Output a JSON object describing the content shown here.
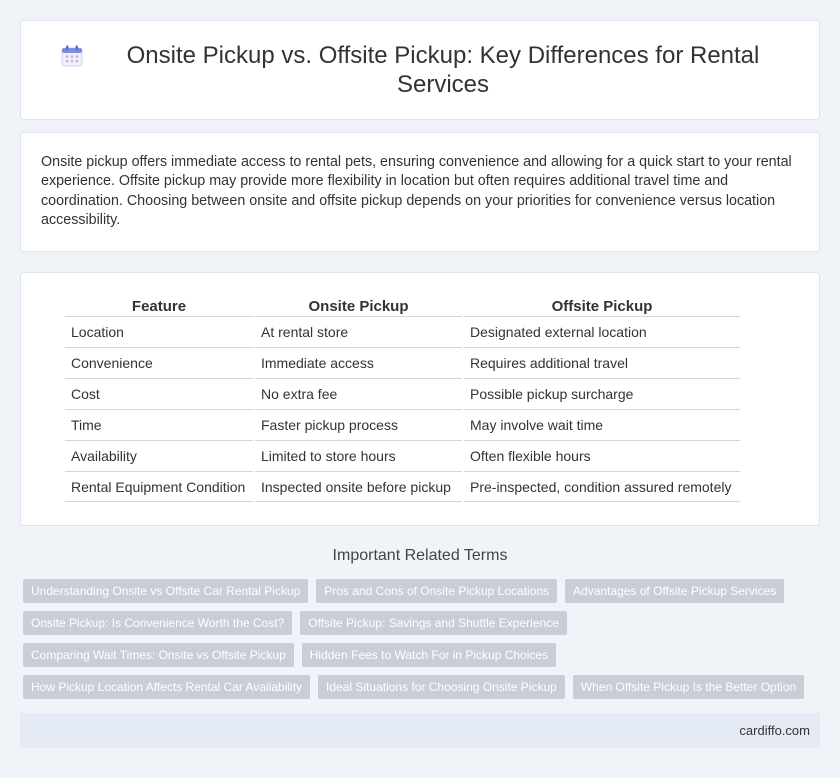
{
  "header": {
    "title": "Onsite Pickup vs. Offsite Pickup: Key Differences for Rental Services",
    "icon": "calendar-icon"
  },
  "intro": {
    "text": "Onsite pickup offers immediate access to rental pets, ensuring convenience and allowing for a quick start to your rental experience. Offsite pickup may provide more flexibility in location but often requires additional travel time and coordination. Choosing between onsite and offsite pickup depends on your priorities for convenience versus location accessibility."
  },
  "table": {
    "headers": [
      "Feature",
      "Onsite Pickup",
      "Offsite Pickup"
    ],
    "rows": [
      [
        "Location",
        "At rental store",
        "Designated external location"
      ],
      [
        "Convenience",
        "Immediate access",
        "Requires additional travel"
      ],
      [
        "Cost",
        "No extra fee",
        "Possible pickup surcharge"
      ],
      [
        "Time",
        "Faster pickup process",
        "May involve wait time"
      ],
      [
        "Availability",
        "Limited to store hours",
        "Often flexible hours"
      ],
      [
        "Rental Equipment Condition",
        "Inspected onsite before pickup",
        "Pre-inspected, condition assured remotely"
      ]
    ]
  },
  "related": {
    "title": "Important Related Terms",
    "rows": [
      [
        "Understanding Onsite vs Offsite Car Rental Pickup",
        "Pros and Cons of Onsite Pickup Locations",
        "Advantages of Offsite Pickup Services"
      ],
      [
        "Onsite Pickup: Is Convenience Worth the Cost?",
        "Offsite Pickup: Savings and Shuttle Experience"
      ],
      [
        "Comparing Wait Times: Onsite vs Offsite Pickup",
        "Hidden Fees to Watch For in Pickup Choices"
      ],
      [
        "How Pickup Location Affects Rental Car Availability",
        "Ideal Situations for Choosing Onsite Pickup",
        "When Offsite Pickup Is the Better Option"
      ]
    ]
  },
  "footer": {
    "site": "cardiffo.com"
  },
  "colors": {
    "background": "#f0f3f8",
    "tag": "#c8ced6",
    "footer": "#e4ebf5"
  }
}
